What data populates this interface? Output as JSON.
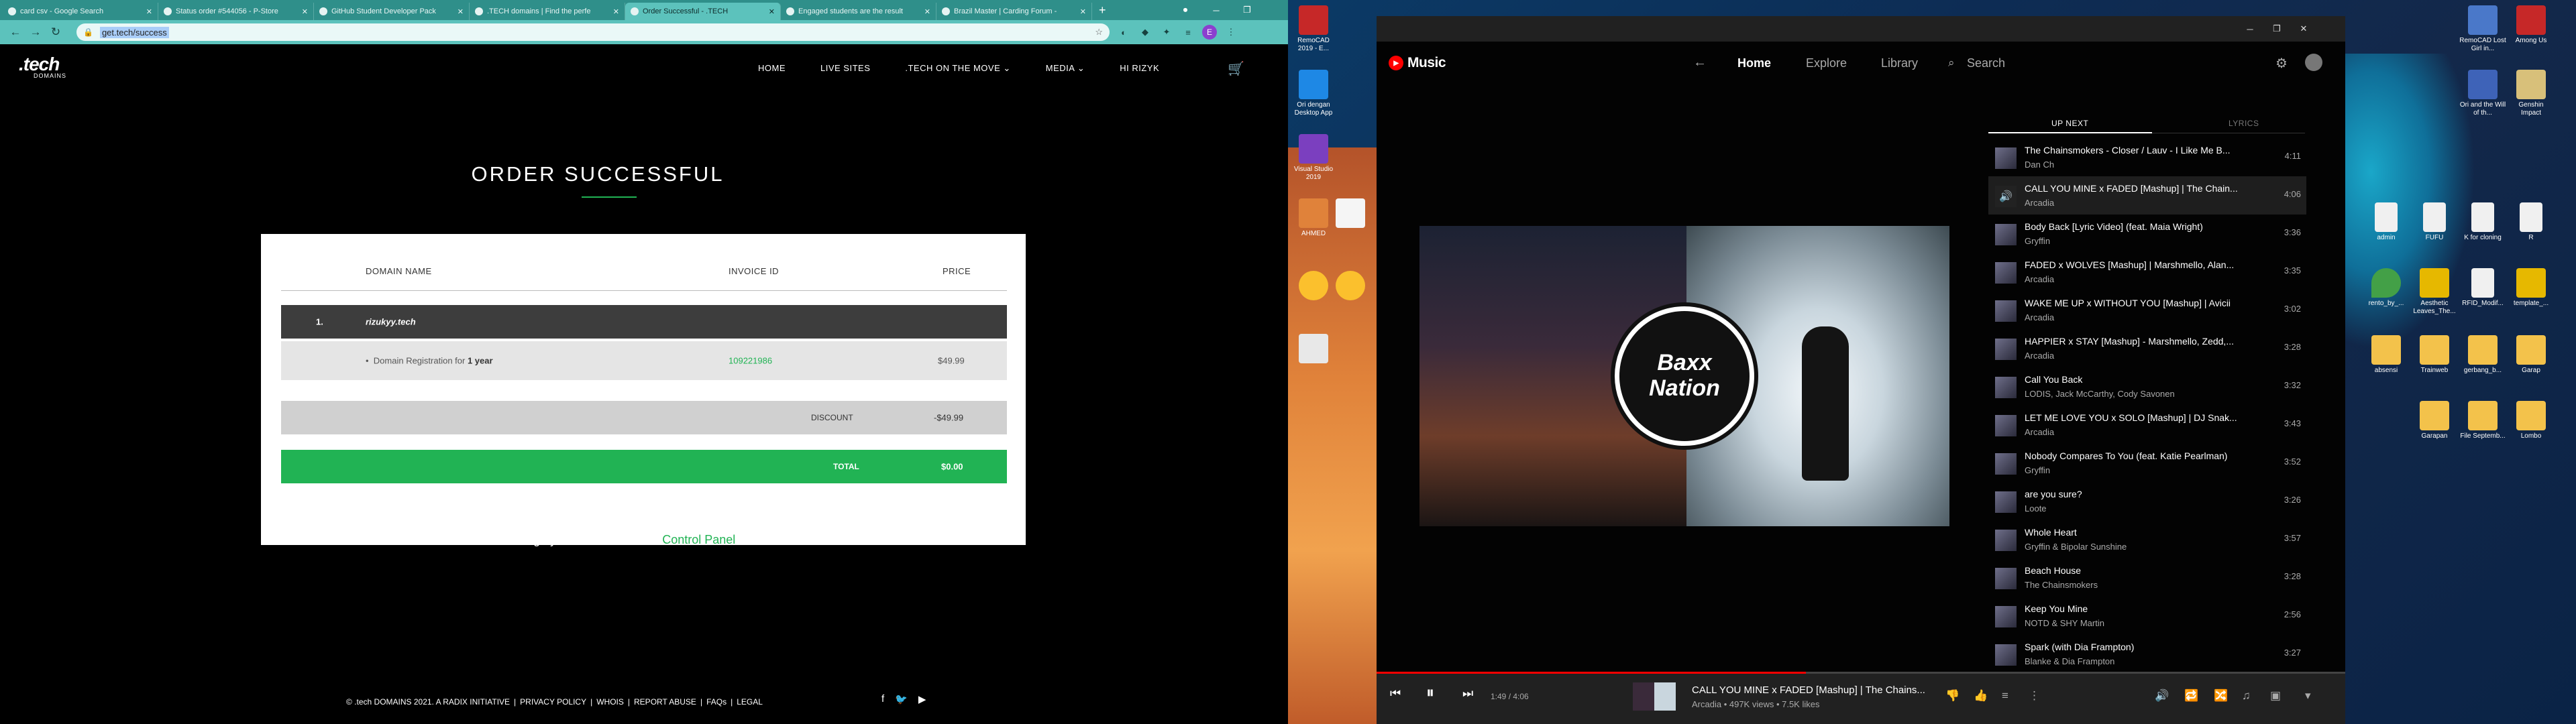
{
  "chrome": {
    "tabs": [
      {
        "title": "card csv - Google Search"
      },
      {
        "title": "Status order #544056 - P-Store"
      },
      {
        "title": "GitHub Student Developer Pack"
      },
      {
        "title": ".TECH domains | Find the perfe"
      },
      {
        "title": "Order Successful - .TECH"
      },
      {
        "title": "Engaged students are the result"
      },
      {
        "title": "Brazil Master | Carding Forum -"
      }
    ],
    "new_tab_label": "+",
    "url": "get.tech/success",
    "profile_initial": "E"
  },
  "site": {
    "logo": ".tech",
    "logo_sub": "DOMAINS",
    "nav": [
      "HOME",
      "LIVE SITES",
      ".TECH ON THE MOVE ⌄",
      "MEDIA ⌄",
      "HI RIZYK"
    ],
    "page_title": "ORDER SUCCESSFUL",
    "table": {
      "col_domain": "DOMAIN NAME",
      "col_invoice": "INVOICE ID",
      "col_price": "PRICE",
      "row_index": "1.",
      "domain": "rizukyy.tech",
      "item_desc": "Domain Registration for",
      "item_period": "1 year",
      "invoice_id": "109221986",
      "item_price": "$49.99",
      "discount_label": "DISCOUNT",
      "discount_value": "-$49.99",
      "total_label": "TOTAL",
      "total_value": "$0.00"
    },
    "manage_text": "You can manage your orders from the",
    "manage_link": "Control Panel",
    "manage_end": ".",
    "footer": {
      "copyright": "© .tech DOMAINS 2021. A RADIX INITIATIVE",
      "links": [
        "PRIVACY POLICY",
        "WHOIS",
        "REPORT ABUSE",
        "FAQs",
        "LEGAL"
      ]
    }
  },
  "desktop": {
    "left_icons": [
      "RemoCAD 2019 - E...",
      "Ori dengan Desktop App",
      "Visual Studio 2019",
      "AHMED",
      "",
      "",
      "",
      "",
      ""
    ],
    "right_icons": [
      "RemoCAD Lost Girl in...",
      "Among Us",
      "Ori and the Will of th...",
      "Genshin Impact",
      "admin",
      "FUFU",
      "K for cloning",
      "R",
      "rento_by_...",
      "Aesthetic Leaves_The...",
      "RFID_Modif...",
      "template_...",
      "absensi",
      "Trainweb",
      "gerbang_b...",
      "Garap",
      "Garapan",
      "File Septemb...",
      "Lombo"
    ]
  },
  "ytm": {
    "logo_text": "Music",
    "nav": [
      "Home",
      "Explore",
      "Library"
    ],
    "search_label": "Search",
    "tab_upnext": "UP NEXT",
    "tab_lyrics": "LYRICS",
    "queue": [
      {
        "title": "The Chainsmokers - Closer / Lauv - I Like Me B...",
        "artist": "Dan Ch",
        "duration": "4:11"
      },
      {
        "title": "CALL YOU MINE x FADED [Mashup] | The Chain...",
        "artist": "Arcadia",
        "duration": "4:06"
      },
      {
        "title": "Body Back [Lyric Video] (feat. Maia Wright)",
        "artist": "Gryffin",
        "duration": "3:36"
      },
      {
        "title": "FADED x WOLVES [Mashup] | Marshmello, Alan...",
        "artist": "Arcadia",
        "duration": "3:35"
      },
      {
        "title": "WAKE ME UP x WITHOUT YOU [Mashup] | Avicii",
        "artist": "Arcadia",
        "duration": "3:02"
      },
      {
        "title": "HAPPIER x STAY [Mashup] - Marshmello, Zedd,...",
        "artist": "Arcadia",
        "duration": "3:28"
      },
      {
        "title": "Call You Back",
        "artist": "LODIS, Jack McCarthy, Cody Savonen",
        "duration": "3:32"
      },
      {
        "title": "LET ME LOVE YOU x SOLO [Mashup] | DJ Snak...",
        "artist": "Arcadia",
        "duration": "3:43"
      },
      {
        "title": "Nobody Compares To You (feat. Katie Pearlman)",
        "artist": "Gryffin",
        "duration": "3:52"
      },
      {
        "title": "are you sure?",
        "artist": "Loote",
        "duration": "3:26"
      },
      {
        "title": "Whole Heart",
        "artist": "Gryffin & Bipolar Sunshine",
        "duration": "3:57"
      },
      {
        "title": "Beach House",
        "artist": "The Chainsmokers",
        "duration": "3:28"
      },
      {
        "title": "Keep You Mine",
        "artist": "NOTD & SHY Martin",
        "duration": "2:56"
      },
      {
        "title": "Spark (with Dia Frampton)",
        "artist": "Blanke & Dia Frampton",
        "duration": "3:27"
      }
    ],
    "now_playing": {
      "title": "CALL YOU MINE x FADED [Mashup] | The Chains...",
      "meta": "Arcadia • 497K views • 7.5K likes",
      "time": "1:49 / 4:06",
      "progress": 0.443
    },
    "art_text": "Baxx Nation"
  },
  "colors": {
    "accent_green": "#21b354",
    "yt_red": "#ff0000",
    "tab_teal": "#5cc2bc"
  }
}
